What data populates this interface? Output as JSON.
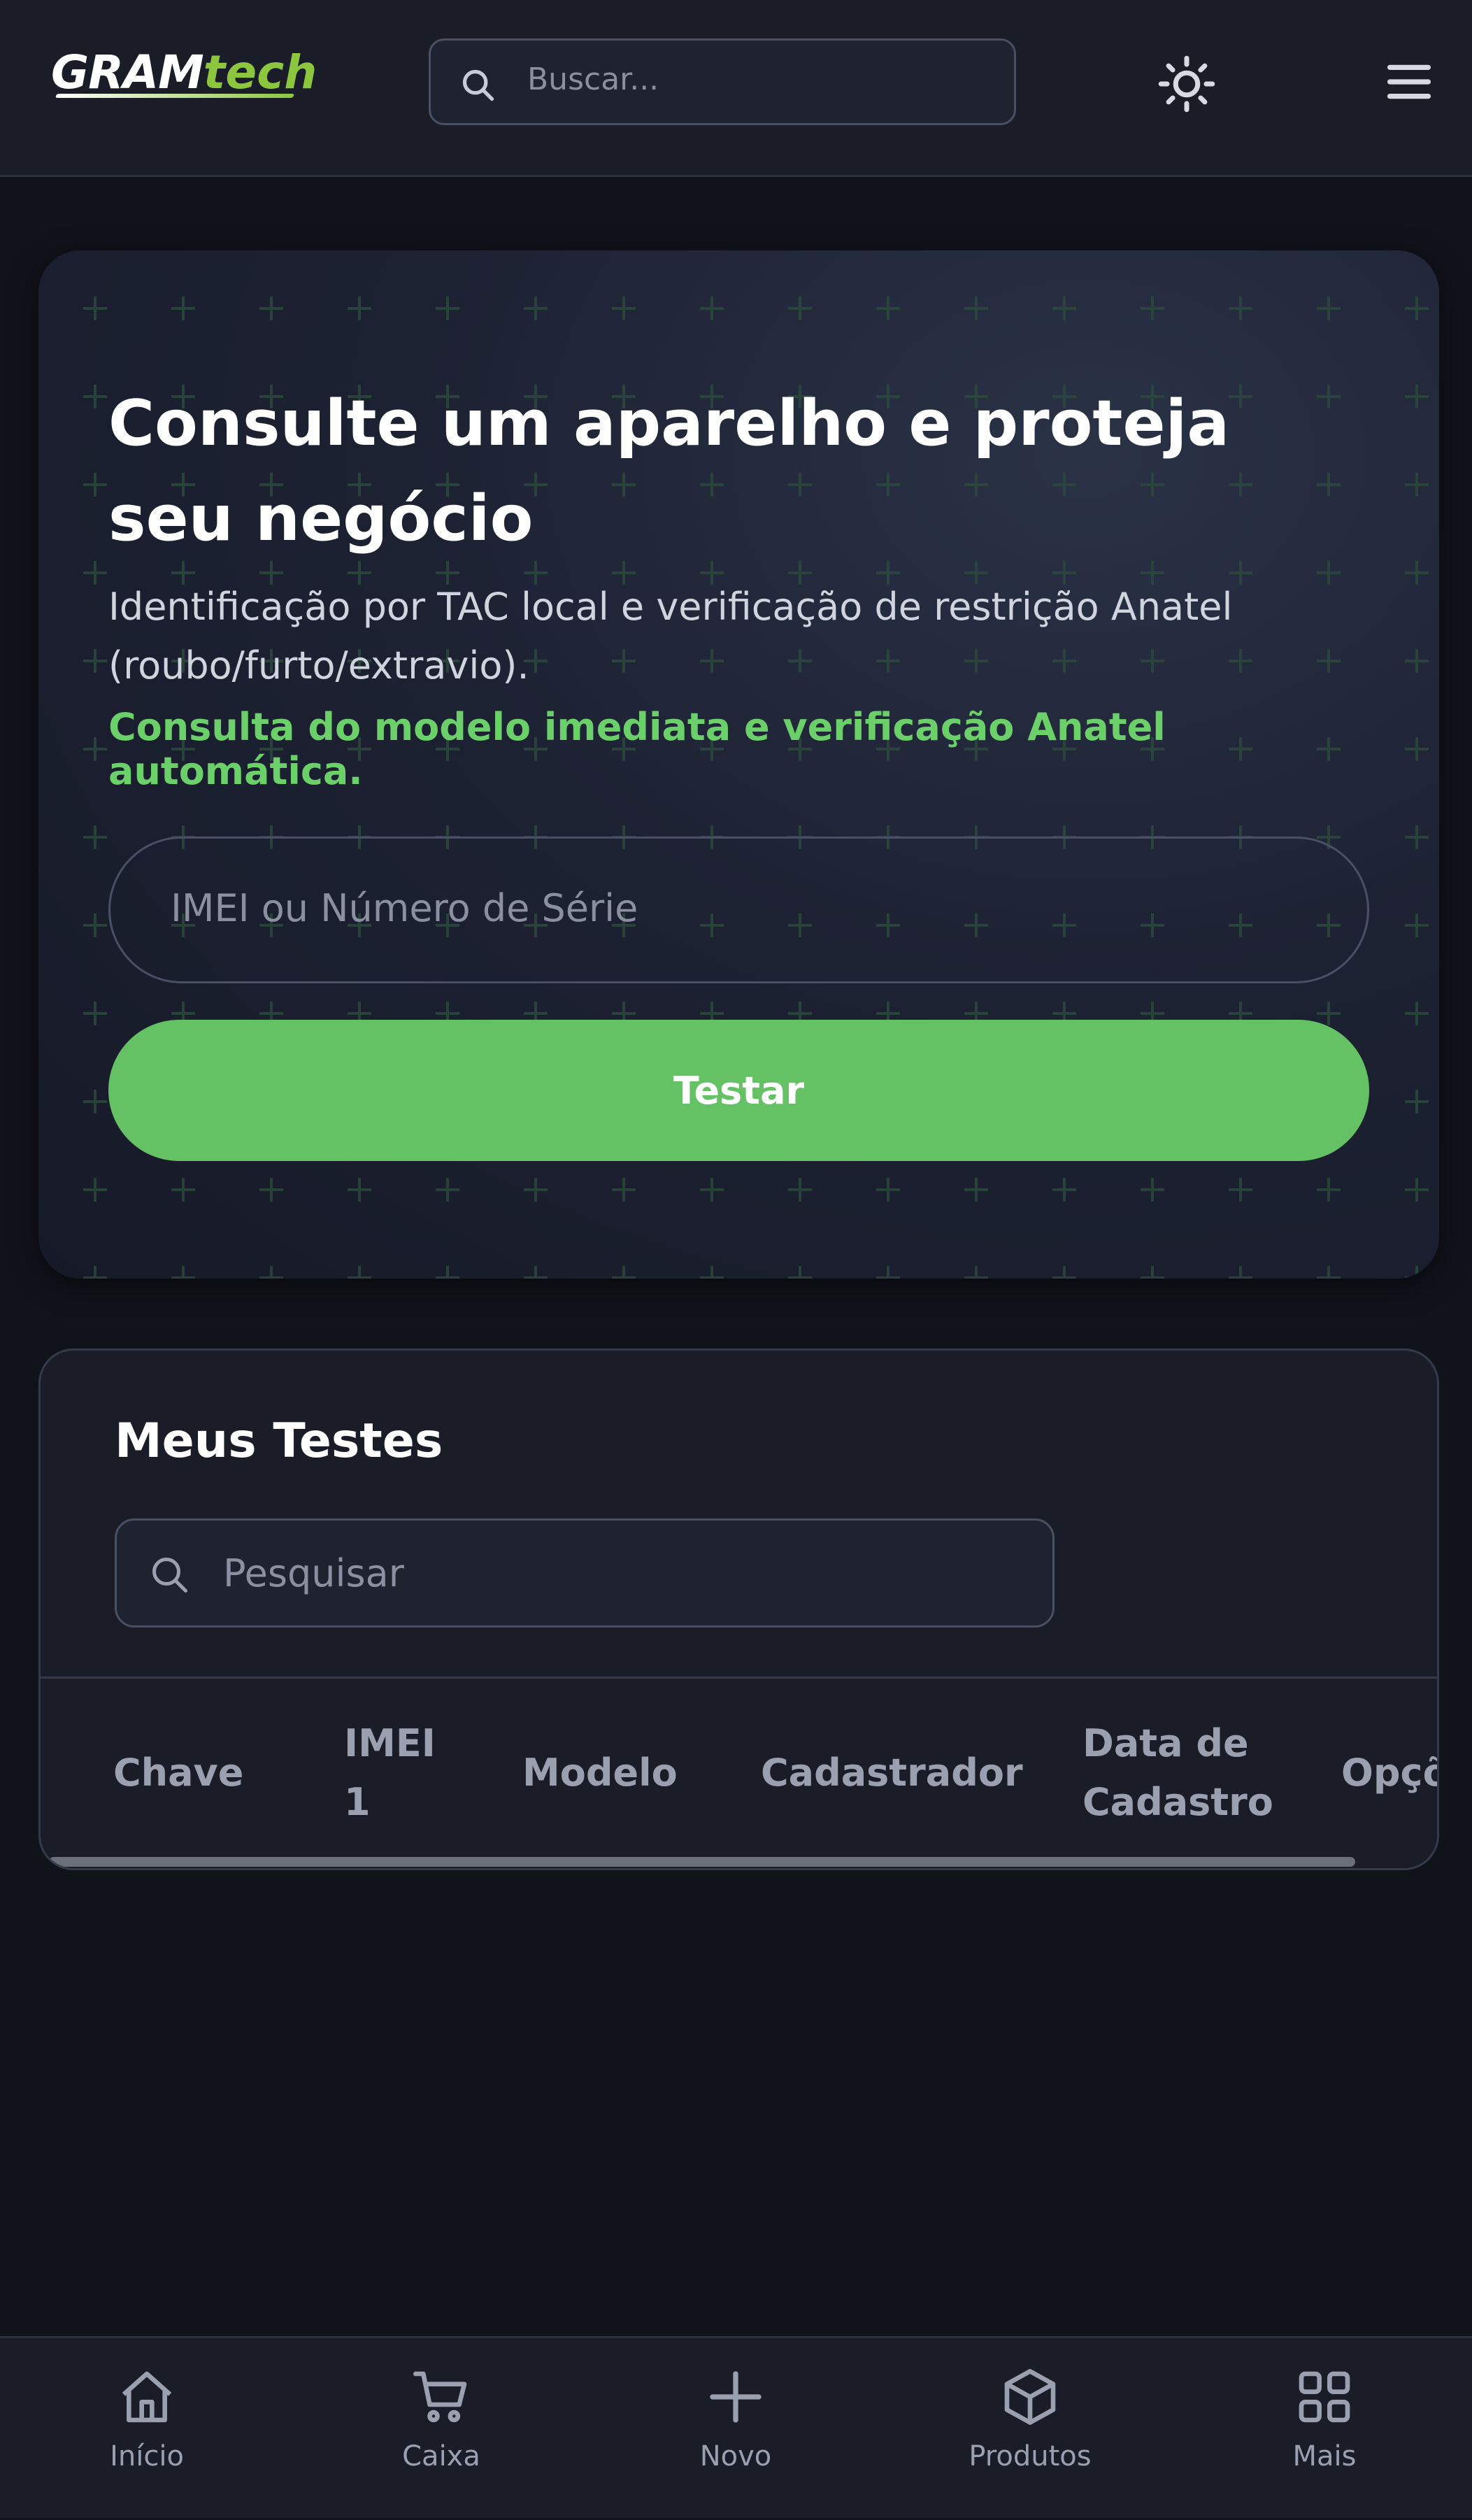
{
  "header": {
    "logo_gram": "GRAM",
    "logo_tech": "tech",
    "search_placeholder": "Buscar..."
  },
  "hero": {
    "title": "Consulte um aparelho e proteja seu negócio",
    "description": "Identificação por TAC local e verificação de restrição Anatel (roubo/furto/extravio).",
    "highlight": "Consulta do modelo imediata e verificação Anatel automática.",
    "input_placeholder": "IMEI ou Número de Série",
    "button_label": "Testar"
  },
  "tests": {
    "title": "Meus Testes",
    "search_placeholder": "Pesquisar",
    "columns": [
      "Chave",
      "IMEI 1",
      "Modelo",
      "Cadastrador",
      "Data de Cadastro",
      "Opçõ"
    ]
  },
  "bottom_nav": {
    "items": [
      {
        "label": "Início",
        "icon": "home-icon"
      },
      {
        "label": "Caixa",
        "icon": "cart-icon"
      },
      {
        "label": "Novo",
        "icon": "plus-icon"
      },
      {
        "label": "Produtos",
        "icon": "box-icon"
      },
      {
        "label": "Mais",
        "icon": "grid-icon"
      }
    ]
  },
  "colors": {
    "background": "#11131a",
    "surface": "#1a1d27",
    "accent_green": "#64c164",
    "highlight_green": "#6cd06a",
    "logo_green": "#8cc63f"
  }
}
